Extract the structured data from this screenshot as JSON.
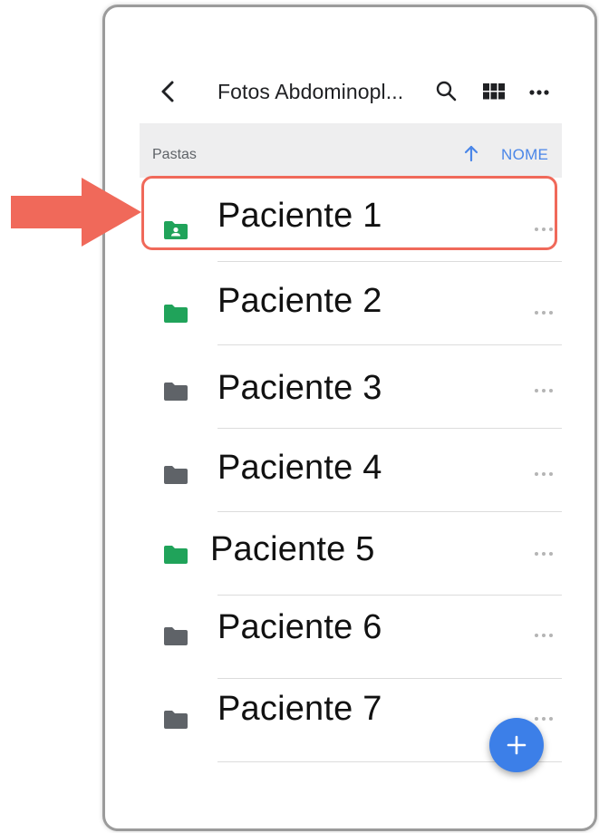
{
  "app_bar": {
    "title": "Fotos Abdominopl...",
    "back_icon": "chevron-left-icon",
    "search_icon": "search-icon",
    "grid_icon": "grid-view-icon",
    "more_icon": "more-horizontal-icon"
  },
  "sort_bar": {
    "section_label": "Pastas",
    "sort_direction_icon": "arrow-up-icon",
    "sort_field": "NOME"
  },
  "folders": [
    {
      "name": "Paciente 1",
      "icon": "shared-folder-icon",
      "color": "#20a35a"
    },
    {
      "name": "Paciente 2",
      "icon": "folder-icon",
      "color": "#20a35a"
    },
    {
      "name": "Paciente 3",
      "icon": "folder-icon",
      "color": "#5f6368"
    },
    {
      "name": "Paciente 4",
      "icon": "folder-icon",
      "color": "#5f6368"
    },
    {
      "name": "Paciente 5",
      "icon": "folder-icon",
      "color": "#20a35a"
    },
    {
      "name": "Paciente 6",
      "icon": "folder-icon",
      "color": "#5f6368"
    },
    {
      "name": "Paciente 7",
      "icon": "folder-icon",
      "color": "#5f6368"
    }
  ],
  "fab": {
    "icon": "plus-icon",
    "color": "#3c7fe8"
  },
  "annotation": {
    "arrow_color": "#f0695a",
    "highlight_color": "#f0695a"
  }
}
